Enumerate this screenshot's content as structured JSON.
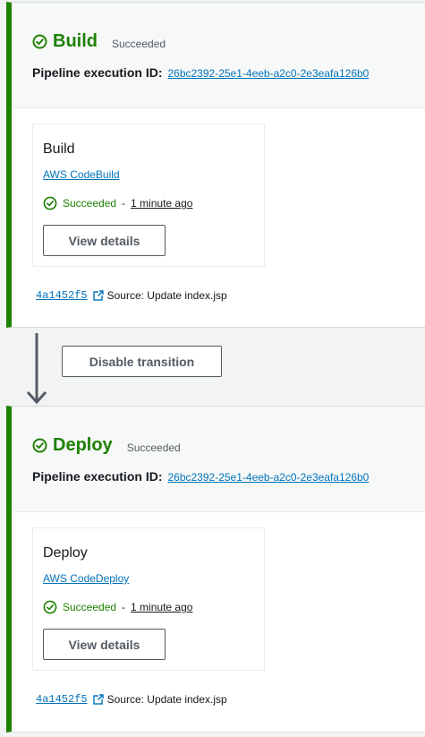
{
  "colors": {
    "success_green": "#1d8102",
    "link_blue": "#0073bb",
    "stage_border": "#1d8102"
  },
  "icons": {
    "status": "check-circle-icon",
    "external": "external-link-icon",
    "transition": "arrow-down-icon"
  },
  "stages": [
    {
      "name": "Build",
      "status": "Succeeded",
      "exec_label": "Pipeline execution ID:",
      "exec_id": "26bc2392-25e1-4eeb-a2c0-2e3eafa126b0",
      "action": {
        "name": "Build",
        "provider": "AWS CodeBuild",
        "status": "Succeeded",
        "separator": "-",
        "time": "1 minute ago",
        "button": "View details"
      },
      "source": {
        "commit": "4a1452f5",
        "text": "Source: Update index.jsp"
      }
    },
    {
      "name": "Deploy",
      "status": "Succeeded",
      "exec_label": "Pipeline execution ID:",
      "exec_id": "26bc2392-25e1-4eeb-a2c0-2e3eafa126b0",
      "action": {
        "name": "Deploy",
        "provider": "AWS CodeDeploy",
        "status": "Succeeded",
        "separator": "-",
        "time": "1 minute ago",
        "button": "View details"
      },
      "source": {
        "commit": "4a1452f5",
        "text": "Source: Update index.jsp"
      }
    }
  ],
  "transition": {
    "button": "Disable transition"
  }
}
